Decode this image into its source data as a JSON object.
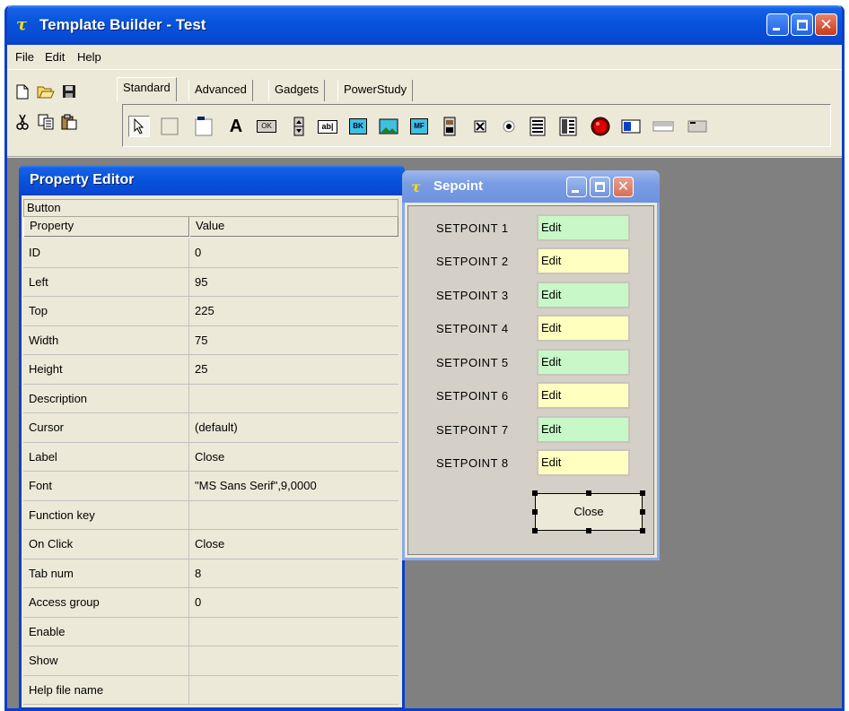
{
  "window": {
    "title": "Template Builder - Test",
    "logo_icon": "template-builder-logo"
  },
  "menu": [
    "File",
    "Edit",
    "Help"
  ],
  "toolbar": {
    "file_icons": [
      "new-file-icon",
      "open-folder-icon",
      "save-disk-icon"
    ],
    "edit_icons": [
      "cut-icon",
      "copy-icon",
      "paste-icon"
    ],
    "tabs": [
      {
        "label": "Standard",
        "active": true
      },
      {
        "label": "Advanced",
        "active": false
      },
      {
        "label": "Gadgets",
        "active": false
      },
      {
        "label": "PowerStudy",
        "active": false
      }
    ],
    "palette_icons": [
      "pointer-icon",
      "frame-icon",
      "panel-icon",
      "text-icon",
      "button-icon",
      "spinner-icon",
      "edit-field-icon",
      "bitmap-icon",
      "image-icon",
      "metafile-icon",
      "device-icon",
      "checkbox-icon",
      "radio-icon",
      "list-icon",
      "grid-icon",
      "led-icon",
      "bargraph-icon",
      "progressbar-icon",
      "statusbar-icon"
    ],
    "palette_labels": {
      "text": "A",
      "button": "OK",
      "edit": "ab|",
      "bitmap": "BK",
      "metafile": "MF"
    }
  },
  "property_editor": {
    "title": "Property Editor",
    "object_type": "Button",
    "columns": [
      "Property",
      "Value"
    ],
    "rows": [
      {
        "name": "ID",
        "value": "0"
      },
      {
        "name": "Left",
        "value": "95"
      },
      {
        "name": "Top",
        "value": "225"
      },
      {
        "name": "Width",
        "value": "75"
      },
      {
        "name": "Height",
        "value": "25"
      },
      {
        "name": "Description",
        "value": ""
      },
      {
        "name": "Cursor",
        "value": "(default)"
      },
      {
        "name": "Label",
        "value": "Close"
      },
      {
        "name": "Font",
        "value": "\"MS Sans Serif\",9,0000"
      },
      {
        "name": "Function key",
        "value": ""
      },
      {
        "name": "On Click",
        "value": "Close"
      },
      {
        "name": "Tab num",
        "value": "8"
      },
      {
        "name": "Access group",
        "value": "0"
      },
      {
        "name": "Enable",
        "value": ""
      },
      {
        "name": "Show",
        "value": ""
      },
      {
        "name": "Help file name",
        "value": ""
      }
    ]
  },
  "sepoint": {
    "title": "Sepoint",
    "rows": [
      {
        "label": "SETPOINT 1",
        "value": "Edit",
        "color": "#C8F7C8"
      },
      {
        "label": "SETPOINT 2",
        "value": "Edit",
        "color": "#FFFFC0"
      },
      {
        "label": "SETPOINT 3",
        "value": "Edit",
        "color": "#C8F7C8"
      },
      {
        "label": "SETPOINT 4",
        "value": "Edit",
        "color": "#FFFFC0"
      },
      {
        "label": "SETPOINT 5",
        "value": "Edit",
        "color": "#C8F7C8"
      },
      {
        "label": "SETPOINT 6",
        "value": "Edit",
        "color": "#FFFFC0"
      },
      {
        "label": "SETPOINT 7",
        "value": "Edit",
        "color": "#C8F7C8"
      },
      {
        "label": "SETPOINT 8",
        "value": "Edit",
        "color": "#FFFFC0"
      }
    ],
    "close_label": "Close"
  },
  "colors": {
    "xp_title_blue": "#0855DD",
    "dialog_face": "#ECE9D8",
    "workspace_gray": "#808080",
    "close_red": "#C73B1A"
  }
}
